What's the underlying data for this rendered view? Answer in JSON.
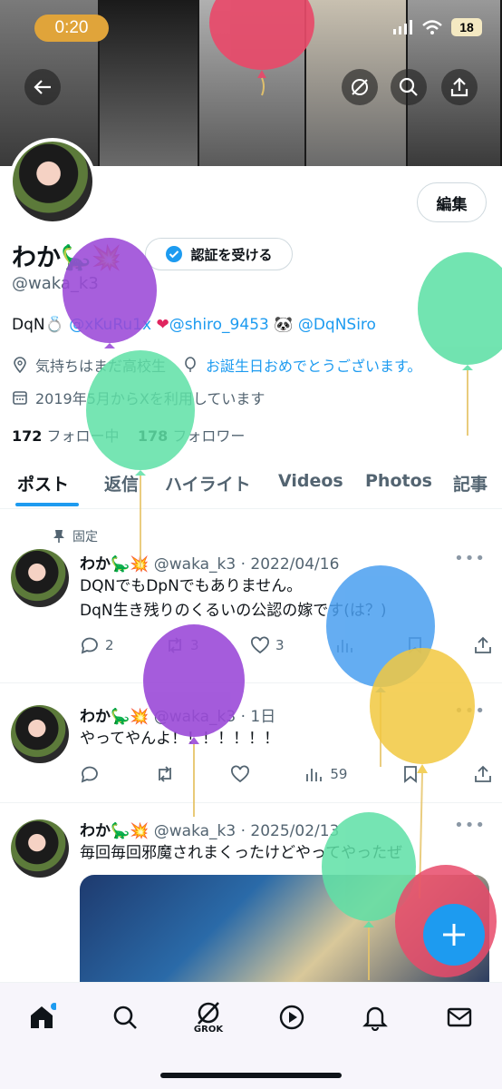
{
  "status_bar": {
    "time": "0:20",
    "battery": "18"
  },
  "profile": {
    "edit_label": "編集",
    "name": "わか",
    "verify_label": "認証を受ける",
    "handle": "@waka_k3",
    "bio_prefix": "DqN",
    "bio_link1": "@xKuRu1x",
    "bio_link2": "@shiro_9453",
    "bio_link3": "@DqNSiro",
    "location": "気持ちはまだ高校生",
    "website": "お誕生日おめでとうございます。",
    "joined": "2019年5月からXを利用しています",
    "following_count": "172",
    "following_label": "フォロー中",
    "followers_count": "178",
    "followers_label": "フォロワー"
  },
  "tabs": [
    "ポスト",
    "返信",
    "ハイライト",
    "Videos",
    "Photos",
    "記事"
  ],
  "pinned_label": "固定",
  "posts": [
    {
      "name": "わか",
      "handle_date": "@waka_k3 · 2022/04/16",
      "line1": "DQNでもDpNでもありません。",
      "line2": "DqN生き残りのくるいの公認の嫁です(は？)",
      "replies": "2",
      "reposts": "3",
      "likes": "3"
    },
    {
      "name": "わか",
      "handle_date": "@waka_k3 · 1日",
      "line1": "やってやんよ！！！！！！！",
      "views": "59"
    },
    {
      "name": "わか",
      "handle_date": "@waka_k3 · 2025/02/13",
      "line1": "毎回毎回邪魔されまくったけどやってやったぜ"
    }
  ],
  "nav": {
    "grok_label": "GROK"
  },
  "colors": {
    "accent": "#1d9bf0",
    "text": "#0f1419",
    "muted": "#536471"
  }
}
